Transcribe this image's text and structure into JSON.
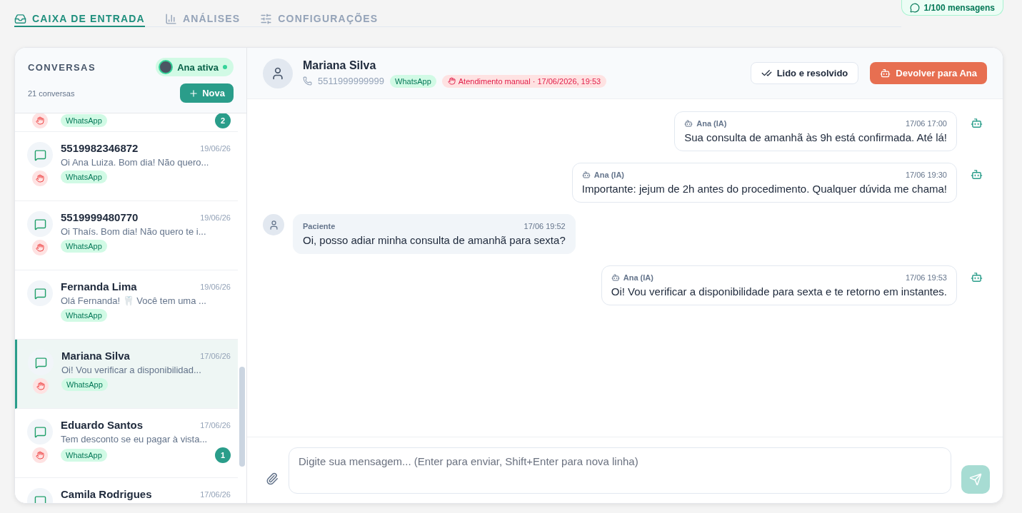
{
  "top_nav": {
    "tabs": [
      {
        "label": "CAIXA DE ENTRADA",
        "selected": true
      },
      {
        "label": "ANÁLISES",
        "selected": false
      },
      {
        "label": "CONFIGURAÇÕES",
        "selected": false
      }
    ],
    "usage": "1/100 mensagens"
  },
  "sidebar": {
    "title": "CONVERSAS",
    "agent_status": {
      "label": "Ana ativa",
      "on": true
    },
    "count": "21 conversas",
    "new_button": "Nova",
    "conversations": [
      {
        "kind": "partial",
        "channel": "WhatsApp",
        "manual": true,
        "unread": "2",
        "selected": false
      },
      {
        "kind": "full",
        "name": "5519982346872",
        "date": "19/06/26",
        "preview": "Oi Ana Luiza. Bom dia! Não quero...",
        "channel": "WhatsApp",
        "manual": true,
        "selected": false
      },
      {
        "kind": "full",
        "name": "5519999480770",
        "date": "19/06/26",
        "preview": "Oi Thaís. Bom dia! Não quero te i...",
        "channel": "WhatsApp",
        "manual": true,
        "selected": false
      },
      {
        "kind": "full",
        "name": "Fernanda Lima",
        "date": "19/06/26",
        "preview": "Olá Fernanda! 🦷 Você tem uma ...",
        "channel": "WhatsApp",
        "manual": false,
        "selected": false
      },
      {
        "kind": "full",
        "name": "Mariana Silva",
        "date": "17/06/26",
        "preview": "Oi! Vou verificar a disponibilidad...",
        "channel": "WhatsApp",
        "manual": true,
        "selected": true
      },
      {
        "kind": "full",
        "name": "Eduardo Santos",
        "date": "17/06/26",
        "preview": "Tem desconto se eu pagar à vista...",
        "channel": "WhatsApp",
        "manual": true,
        "unread": "1",
        "selected": false
      },
      {
        "kind": "cut",
        "name": "Camila Rodrigues",
        "date": "17/06/26",
        "selected": false
      }
    ]
  },
  "chat": {
    "contact": {
      "name": "Mariana Silva",
      "phone": "5511999999999",
      "channel": "WhatsApp",
      "manual_badge": "Atendimento manual · 17/06/2026, 19:53"
    },
    "actions": {
      "resolve": "Lido e resolvido",
      "return": "Devolver para Ana"
    },
    "messages": [
      {
        "kind": "bot",
        "author": "Ana (IA)",
        "time": "17/06 17:00",
        "text": "Sua consulta de amanhã às 9h está confirmada. Até lá!"
      },
      {
        "kind": "bot",
        "author": "Ana (IA)",
        "time": "17/06 19:30",
        "text": "Importante: jejum de 2h antes do procedimento. Qualquer dúvida me chama!"
      },
      {
        "kind": "patient",
        "author": "Paciente",
        "time": "17/06 19:52",
        "text": "Oi, posso adiar minha consulta de amanhã para sexta?"
      },
      {
        "kind": "bot",
        "author": "Ana (IA)",
        "time": "17/06 19:53",
        "text": "Oi! Vou verificar a disponibilidade para sexta e te retorno em instantes."
      }
    ],
    "composer": {
      "placeholder": "Digite sua mensagem... (Enter para enviar, Shift+Enter para nova linha)"
    }
  }
}
